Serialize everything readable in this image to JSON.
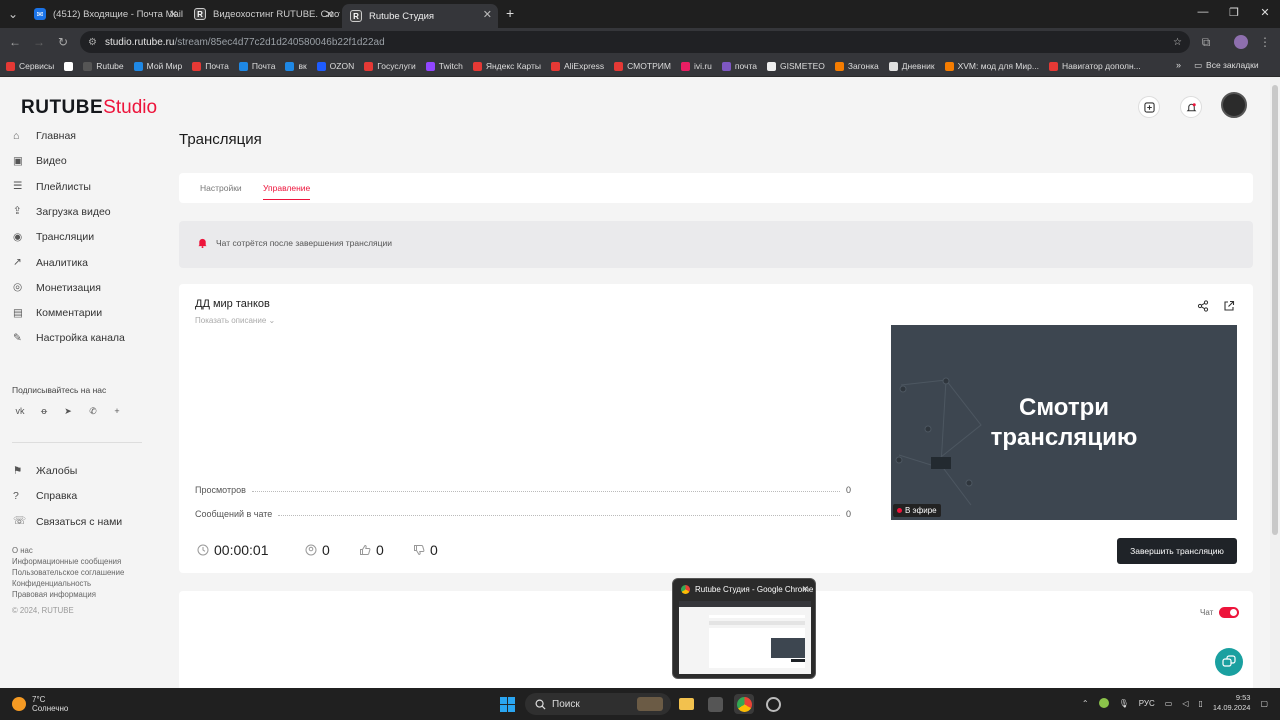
{
  "browser": {
    "tabs": [
      {
        "label": "(4512) Входящие - Почта Mail",
        "favicon_color": "#1a73e8"
      },
      {
        "label": "Видеохостинг RUTUBE. Смотр",
        "favicon_color": "#444"
      },
      {
        "label": "Rutube Студия",
        "favicon_color": "#444"
      }
    ],
    "new_tab": "+",
    "url_host": "studio.rutube.ru",
    "url_path": "/stream/85ec4d77c2d1d240580046b22f1d22ad",
    "bookmarks": [
      {
        "label": "Сервисы",
        "color": "#e53935"
      },
      {
        "label": "",
        "color": "#ffffff"
      },
      {
        "label": "Rutube",
        "color": "#555"
      },
      {
        "label": "Мой Мир",
        "color": "#1e88e5"
      },
      {
        "label": "Почта",
        "color": "#e53935"
      },
      {
        "label": "Почта",
        "color": "#1e88e5"
      },
      {
        "label": "вк",
        "color": "#1e88e5"
      },
      {
        "label": "OZON",
        "color": "#1e5cff"
      },
      {
        "label": "Госуслуги",
        "color": "#e53935"
      },
      {
        "label": "Twitch",
        "color": "#9146ff"
      },
      {
        "label": "Яндекс Карты",
        "color": "#e53935"
      },
      {
        "label": "AliExpress",
        "color": "#e53935"
      },
      {
        "label": "СМОТРИМ",
        "color": "#e53935"
      },
      {
        "label": "ivi.ru",
        "color": "#e91e63"
      },
      {
        "label": "почта",
        "color": "#7e57c2"
      },
      {
        "label": "GISMETEO",
        "color": "#eee"
      },
      {
        "label": "Загонка",
        "color": "#f57c00"
      },
      {
        "label": "Дневник",
        "color": "#e0e0e0"
      },
      {
        "label": "XVM: мод для Мир...",
        "color": "#f57c00"
      },
      {
        "label": "Навигатор дополн...",
        "color": "#e53935"
      }
    ],
    "bookmarks_more": "»",
    "all_bookmarks": "Все закладки"
  },
  "studio": {
    "logo_main": "RUTUBE",
    "logo_studio": "Studio",
    "nav": [
      {
        "label": "Главная",
        "icon": "home-icon"
      },
      {
        "label": "Видео",
        "icon": "video-icon"
      },
      {
        "label": "Плейлисты",
        "icon": "playlist-icon"
      },
      {
        "label": "Загрузка видео",
        "icon": "upload-icon"
      },
      {
        "label": "Трансляции",
        "icon": "broadcast-icon"
      },
      {
        "label": "Аналитика",
        "icon": "analytics-icon"
      },
      {
        "label": "Монетизация",
        "icon": "money-icon"
      },
      {
        "label": "Комментарии",
        "icon": "comments-icon"
      },
      {
        "label": "Настройка канала",
        "icon": "channel-settings-icon"
      }
    ],
    "social_title": "Подписывайтесь на нас",
    "social": [
      "vk",
      "ok",
      "telegram",
      "viber",
      "+"
    ],
    "nav2": [
      {
        "label": "Жалобы",
        "icon": "flag-icon"
      },
      {
        "label": "Справка",
        "icon": "help-icon"
      },
      {
        "label": "Связаться с нами",
        "icon": "contact-icon"
      }
    ],
    "footer_links": [
      "О нас",
      "Информационные сообщения",
      "Пользовательское соглашение",
      "Конфиденциальность",
      "Правовая информация"
    ],
    "copyright": "© 2024, RUTUBE"
  },
  "page": {
    "title": "Трансляция",
    "tabs": [
      "Настройки",
      "Управление"
    ],
    "active_tab": "Управление",
    "notice": "Чат сотрётся после завершения трансляции",
    "stream": {
      "title": "ДД мир танков",
      "show_description": "Показать описание",
      "stats": [
        {
          "label": "Просмотров",
          "value": "0"
        },
        {
          "label": "Сообщений в чате",
          "value": "0"
        }
      ],
      "preview_text_1": "Смотри",
      "preview_text_2": "трансляцию",
      "live_badge": "В эфире",
      "duration": "00:00:01",
      "viewers": "0",
      "likes": "0",
      "dislikes": "0",
      "end_button": "Завершить трансляцию"
    },
    "chat_label": "Чат"
  },
  "thumbnail_popup": {
    "title": "Rutube Студия - Google Chrome"
  },
  "taskbar": {
    "weather_temp": "7°C",
    "weather_desc": "Солнечно",
    "search": "Поиск",
    "lang": "РУС",
    "time": "9:53",
    "date": "14.09.2024"
  },
  "colors": {
    "accent": "#ed143b",
    "dark": "#1f2328",
    "teal": "#1aa0a0"
  }
}
